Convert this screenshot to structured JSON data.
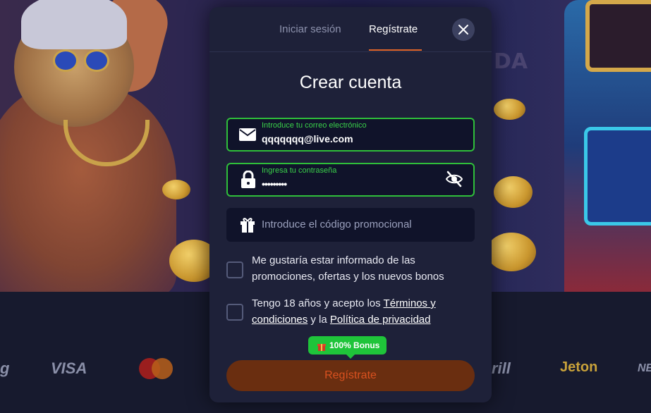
{
  "tabs": [
    {
      "label": "Iniciar sesión",
      "active": false
    },
    {
      "label": "Regístrate",
      "active": true
    }
  ],
  "title": "Crear cuenta",
  "email": {
    "label": "Introduce tu correo electrónico",
    "value": "qqqqqqq@live.com",
    "icon": "envelope-icon"
  },
  "password": {
    "label": "Ingresa tu contraseña",
    "value": "•••••••••",
    "icon": "lock-icon",
    "toggle_icon": "eye-off-icon"
  },
  "promo": {
    "placeholder": "Introduce el código promocional",
    "icon": "gift-icon"
  },
  "checkboxes": {
    "newsletter": {
      "text": "Me gustaría estar informado de las promociones, ofertas y los nuevos bonos",
      "checked": false
    },
    "terms": {
      "prefix": "Tengo 18 años y acepto los ",
      "terms_link": "Términos y condiciones",
      "middle": " y la ",
      "privacy_link": "Política de privacidad",
      "checked": false
    }
  },
  "bonus_badge": "100% Bonus",
  "submit_label": "Regístrate",
  "payment_logos": [
    "g",
    "VISA",
    "Mastercard",
    "rill",
    "Jeton",
    "NE"
  ],
  "background_text": "DA",
  "colors": {
    "accent_orange": "#e0652a",
    "valid_green": "#2fbf3a",
    "modal_bg": "#1e2139",
    "submit_bg": "#6a2e10"
  }
}
